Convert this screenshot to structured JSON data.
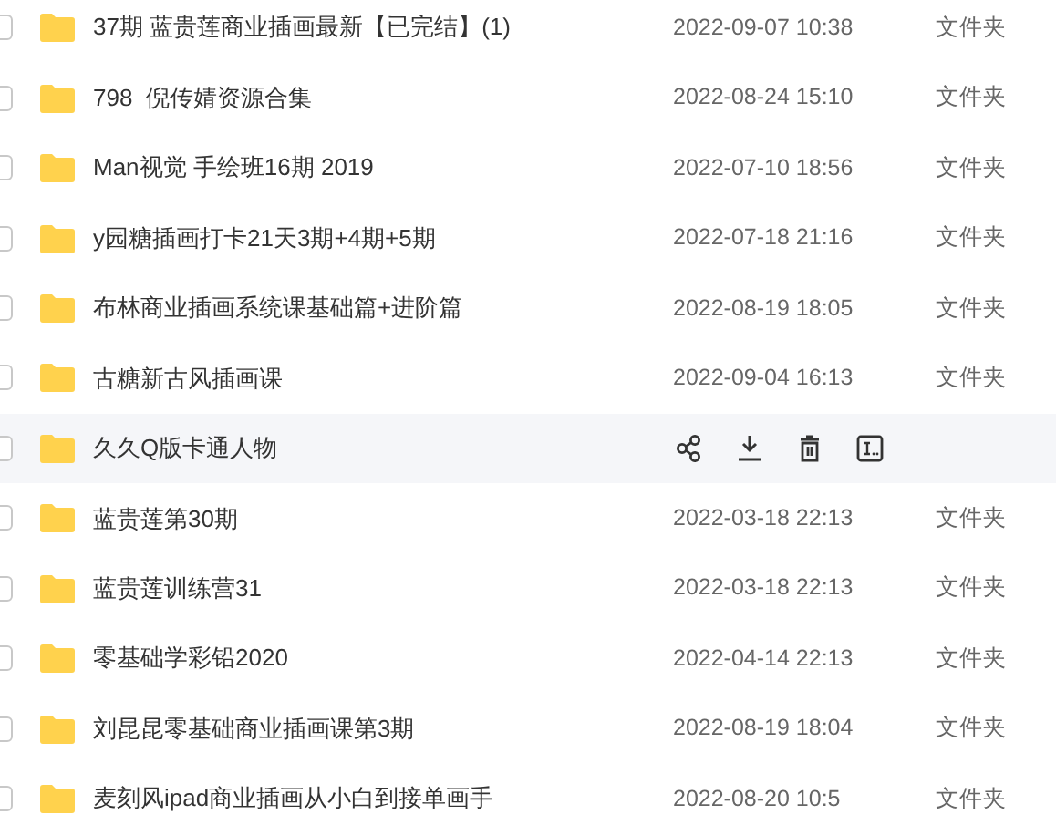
{
  "files": [
    {
      "name": "37期 蓝贵莲商业插画最新【已完结】(1)",
      "modified": "2022-09-07 10:38",
      "type": "文件夹",
      "checked": false,
      "hovered": false
    },
    {
      "name": "798  倪传婧资源合集",
      "modified": "2022-08-24 15:10",
      "type": "文件夹",
      "checked": false,
      "hovered": false
    },
    {
      "name": "Man视觉 手绘班16期 2019",
      "modified": "2022-07-10 18:56",
      "type": "文件夹",
      "checked": false,
      "hovered": false
    },
    {
      "name": "y园糖插画打卡21天3期+4期+5期",
      "modified": "2022-07-18 21:16",
      "type": "文件夹",
      "checked": false,
      "hovered": false
    },
    {
      "name": "布林商业插画系统课基础篇+进阶篇",
      "modified": "2022-08-19 18:05",
      "type": "文件夹",
      "checked": false,
      "hovered": false
    },
    {
      "name": "古糖新古风插画课",
      "modified": "2022-09-04 16:13",
      "type": "文件夹",
      "checked": false,
      "hovered": false
    },
    {
      "name": "久久Q版卡通人物",
      "checked": false,
      "hovered": true
    },
    {
      "name": "蓝贵莲第30期",
      "modified": "2022-03-18 22:13",
      "type": "文件夹",
      "checked": false,
      "hovered": false
    },
    {
      "name": "蓝贵莲训练营31",
      "modified": "2022-03-18 22:13",
      "type": "文件夹",
      "checked": false,
      "hovered": false
    },
    {
      "name": "零基础学彩铅2020",
      "modified": "2022-04-14 22:13",
      "type": "文件夹",
      "checked": false,
      "hovered": false
    },
    {
      "name": "刘昆昆零基础商业插画课第3期",
      "modified": "2022-08-19 18:04",
      "type": "文件夹",
      "checked": false,
      "hovered": false
    },
    {
      "name": "麦刻风ipad商业插画从小白到接单画手",
      "modified": "2022-08-20 10:5",
      "type": "文件夹",
      "checked": false,
      "hovered": false
    }
  ]
}
